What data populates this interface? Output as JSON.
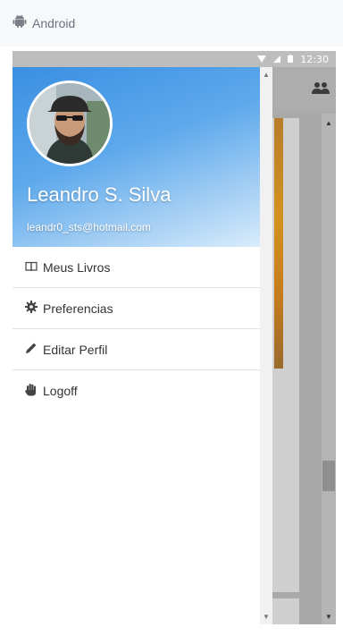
{
  "frame": {
    "platform_label": "Android",
    "platform_icon": "android-icon"
  },
  "status_bar": {
    "time": "12:30",
    "icons": [
      "wifi-icon",
      "signal-icon",
      "battery-icon"
    ]
  },
  "app_bar": {
    "action_icon": "people-icon"
  },
  "drawer": {
    "user": {
      "name": "Leandro S. Silva",
      "email": "leandr0_sts@hotmail.com",
      "avatar_icon": "avatar"
    },
    "menu": [
      {
        "label": "Meus Livros",
        "icon": "book-icon"
      },
      {
        "label": "Preferencias",
        "icon": "gear-icon"
      },
      {
        "label": "Editar Perfil",
        "icon": "pencil-icon"
      },
      {
        "label": "Logoff",
        "icon": "hand-icon"
      }
    ],
    "header_gradient": [
      "#3b8fe2",
      "#d9ecfb"
    ]
  },
  "colors": {
    "scrim": "#a9a9a9",
    "status_bar": "#bdbdbd",
    "divider": "#e3e3e3"
  }
}
